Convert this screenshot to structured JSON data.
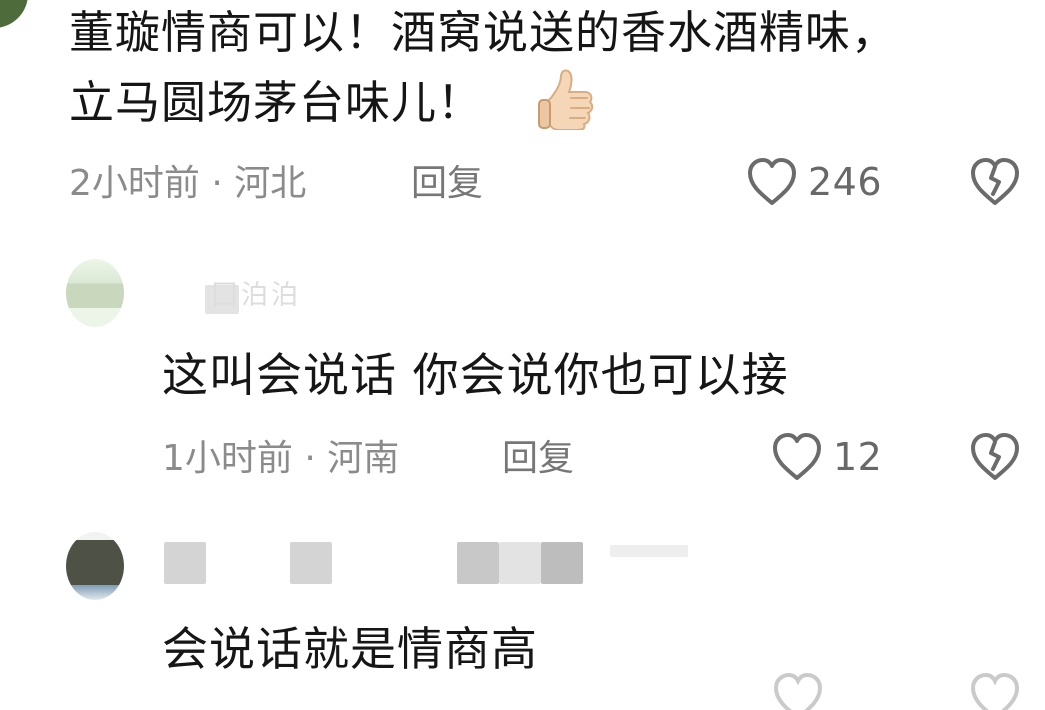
{
  "comment": {
    "text_line1": "董璇情商可以！酒窝说送的香水酒精味，",
    "text_line2": "立马圆场茅台味儿！",
    "emoji_icon": "thumbs-up-icon",
    "time_location": "2小时前 · 河北",
    "reply_label": "回复",
    "like_count": "246",
    "like_icon": "heart-outline-icon",
    "dislike_icon": "broken-heart-icon"
  },
  "replies": [
    {
      "name_partial": "囗泊泊",
      "text": "这叫会说话 你会说你也可以接",
      "time_location": "1小时前 · 河南",
      "reply_label": "回复",
      "like_count": "12"
    },
    {
      "name_partial": "",
      "text": "会说话就是情商高"
    }
  ],
  "colors": {
    "text": "#151515",
    "muted": "#8b8b8b",
    "icon": "#6a6a6a",
    "background": "#ffffff"
  }
}
